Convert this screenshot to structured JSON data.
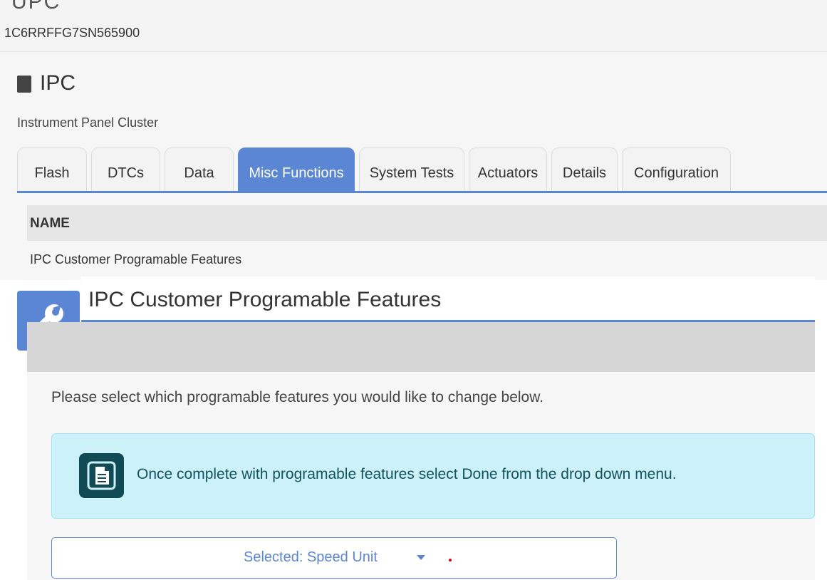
{
  "header": {
    "cut_text": "UPC",
    "vin": "1C6RRFFG7SN565900"
  },
  "module": {
    "title": "IPC",
    "subtitle": "Instrument Panel Cluster"
  },
  "tabs": [
    {
      "label": "Flash",
      "active": false
    },
    {
      "label": "DTCs",
      "active": false
    },
    {
      "label": "Data",
      "active": false
    },
    {
      "label": "Misc Functions",
      "active": true
    },
    {
      "label": "System Tests",
      "active": false
    },
    {
      "label": "Actuators",
      "active": false
    },
    {
      "label": "Details",
      "active": false
    },
    {
      "label": "Configuration",
      "active": false
    }
  ],
  "table": {
    "header": "NAME",
    "rows": [
      "IPC Customer Programable Features"
    ]
  },
  "panel": {
    "title": "IPC Customer Programable Features",
    "icon": "wrench-icon",
    "instruction": "Please select which programable features you would like to change below.",
    "info_icon": "document-icon",
    "info_text": "Once complete with programable features select Done from the drop down menu.",
    "select_label": "Selected: Speed Unit"
  },
  "colors": {
    "accent": "#5b86d4",
    "info_bg": "#cdf1f9",
    "info_text": "#12535f"
  }
}
